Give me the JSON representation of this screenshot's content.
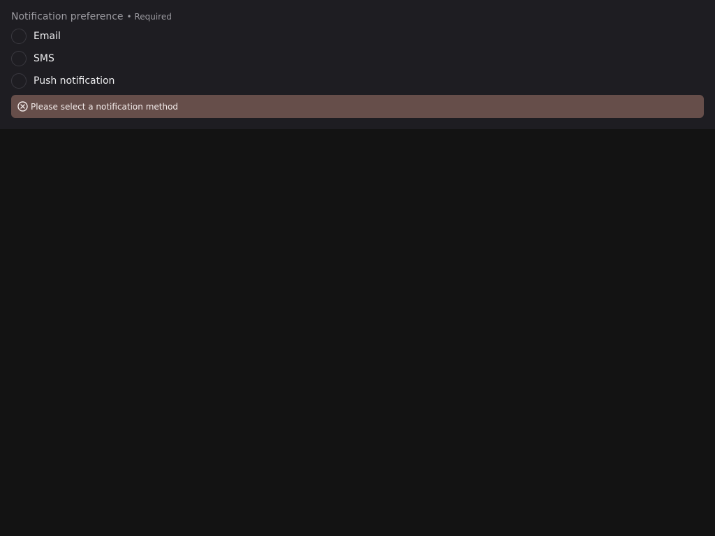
{
  "field": {
    "label": "Notification preference",
    "required_text": "• Required"
  },
  "options": [
    {
      "label": "Email",
      "selected": false
    },
    {
      "label": "SMS",
      "selected": false
    },
    {
      "label": "Push notification",
      "selected": false
    }
  ],
  "error": {
    "icon": "error-circle-x-icon",
    "message": "Please select a notification method"
  },
  "colors": {
    "panel_bg": "#1e1d22",
    "page_bg": "#131313",
    "error_bg": "#664e4a",
    "text_primary": "#ececee",
    "text_muted": "#9b9aa0"
  }
}
